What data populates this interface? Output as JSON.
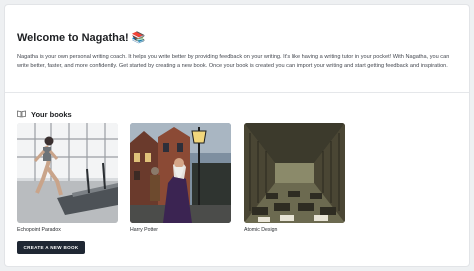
{
  "welcome": {
    "title": "Welcome to Nagatha! 📚",
    "description": "Nagatha is your own personal writing coach. It helps you write better by providing feedback on your writing. It's like having a writing tutor in your pocket! With Nagatha, you can write better, faster, and more confidently. Get started by creating a new book. Once your book is created you can import your writing and start getting feedback and inspiration."
  },
  "books_section": {
    "icon": "open-book-icon",
    "title": "Your books",
    "create_button_label": "CREATE A NEW BOOK"
  },
  "books": [
    {
      "title": "Echopoint Paradox"
    },
    {
      "title": "Harry Potter"
    },
    {
      "title": "Atomic Design"
    }
  ],
  "colors": {
    "page_bg": "#eef0f2",
    "card_bg": "#ffffff",
    "button_bg": "#1f2733",
    "button_text": "#ffffff"
  }
}
